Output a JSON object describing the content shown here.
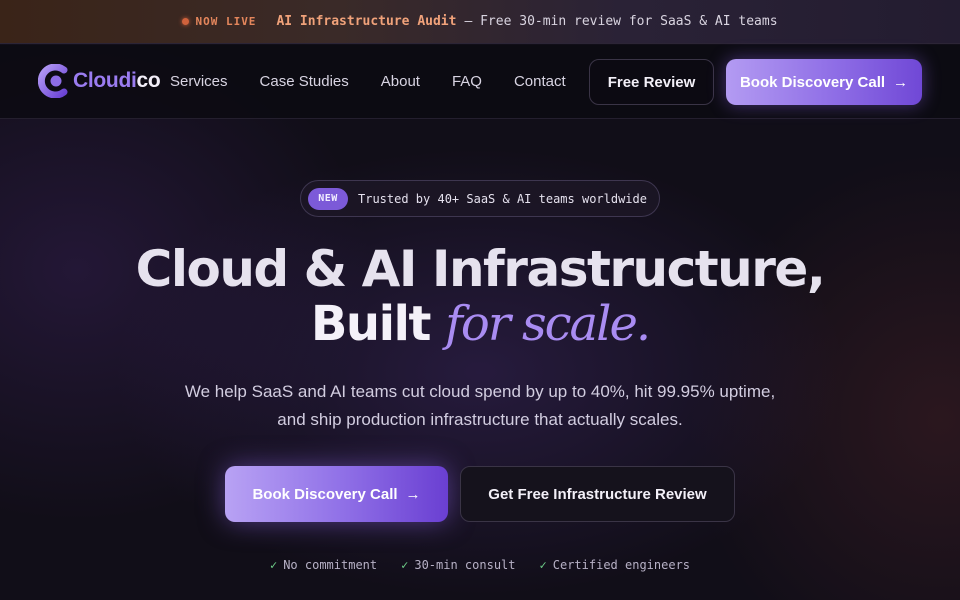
{
  "announcement": {
    "status": "NOW LIVE",
    "headline": "AI Infrastructure Audit",
    "text": "— Free 30-min review for SaaS & AI teams"
  },
  "brand": {
    "name_part1": "Cloudi",
    "name_part2": "co"
  },
  "nav": {
    "links": [
      "Services",
      "Case Studies",
      "About",
      "FAQ",
      "Contact"
    ],
    "free_review": "Free Review",
    "book_call": "Book Discovery Call"
  },
  "hero": {
    "badge_tag": "NEW",
    "badge_text": "Trusted by 40+ SaaS & AI teams worldwide",
    "title_line1": "Cloud & AI Infrastructure,",
    "title_line2_plain": "Built",
    "title_line2_italic": "for scale.",
    "subtitle": "We help SaaS and AI teams cut cloud spend by up to 40%, hit 99.95% uptime, and ship production infrastructure that actually scales.",
    "cta_primary": "Book Discovery Call",
    "cta_secondary": "Get Free Infrastructure Review",
    "checks": [
      "No commitment",
      "30-min consult",
      "Certified engineers"
    ]
  },
  "icons": {
    "arrow": "arrow-right-icon",
    "check": "check-icon",
    "dot": "live-dot-icon"
  },
  "colors": {
    "accent": "#9a7cf0",
    "live": "#e4865c",
    "check": "#6fcf8a"
  }
}
